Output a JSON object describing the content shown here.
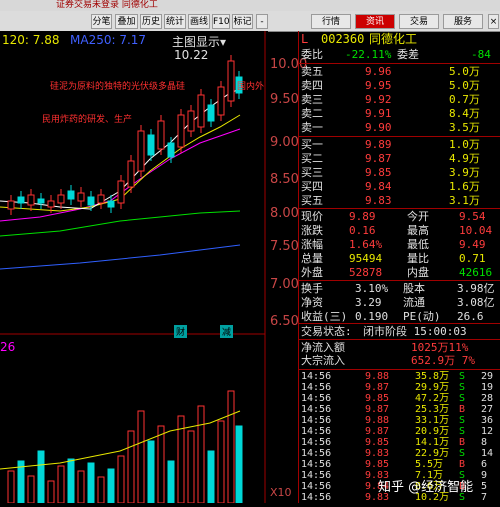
{
  "window_title": "证券交易未登录  同德化工",
  "toolbar": [
    "分笔",
    "叠加",
    "历史",
    "统计",
    "画线",
    "F10",
    "标记",
    "-"
  ],
  "toolbar_right": [
    "行情",
    "资讯",
    "交易",
    "服务"
  ],
  "ma": {
    "ma120": "120: 7.88",
    "ma250": "MA250: 7.17",
    "mode": "主图显示"
  },
  "price_axis": [
    "10.00",
    "9.50",
    "9.00",
    "8.50",
    "8.00",
    "7.50",
    "7.00",
    "6.50"
  ],
  "high_label": "10.22",
  "annotations": [
    "硅泥为原料的独特的光伏级多晶硅",
    "国内外",
    "民用炸药的研发、生产"
  ],
  "vol_scale": "26",
  "vol_axis": "X10",
  "bottom_marks": [
    "财",
    "减"
  ],
  "chart_colors": {
    "up": "#ff3232",
    "down": "#00d8d8",
    "ma5": "#ffffff",
    "ma10": "#e8e800",
    "ma20": "#ff00ff",
    "ma60": "#00e000",
    "ma120": "#3060ff"
  },
  "stock": {
    "code": "002360",
    "name": "同德化工",
    "weibi_label": "委比",
    "weibi": "-22.11%",
    "weicha_label": "委差",
    "weicha": "-84"
  },
  "asks": [
    {
      "label": "卖五",
      "price": "9.96",
      "vol": "5.0万"
    },
    {
      "label": "卖四",
      "price": "9.95",
      "vol": "5.0万"
    },
    {
      "label": "卖三",
      "price": "9.92",
      "vol": "0.7万"
    },
    {
      "label": "卖二",
      "price": "9.91",
      "vol": "8.4万"
    },
    {
      "label": "卖一",
      "price": "9.90",
      "vol": "3.5万"
    }
  ],
  "bids": [
    {
      "label": "买一",
      "price": "9.89",
      "vol": "1.0万"
    },
    {
      "label": "买二",
      "price": "9.87",
      "vol": "4.9万"
    },
    {
      "label": "买三",
      "price": "9.85",
      "vol": "3.9万"
    },
    {
      "label": "买四",
      "price": "9.84",
      "vol": "1.6万"
    },
    {
      "label": "买五",
      "price": "9.83",
      "vol": "3.1万"
    }
  ],
  "stats": [
    {
      "l1": "现价",
      "v1": "9.89",
      "l2": "今开",
      "v2": "9.54",
      "c1": "red",
      "c2": "red"
    },
    {
      "l1": "涨跌",
      "v1": "0.16",
      "l2": "最高",
      "v2": "10.04",
      "c1": "red",
      "c2": "red"
    },
    {
      "l1": "涨幅",
      "v1": "1.64%",
      "l2": "最低",
      "v2": "9.49",
      "c1": "red",
      "c2": "red"
    },
    {
      "l1": "总量",
      "v1": "95494",
      "l2": "量比",
      "v2": "0.71",
      "c1": "yel",
      "c2": "yel"
    },
    {
      "l1": "外盘",
      "v1": "52878",
      "l2": "内盘",
      "v2": "42616",
      "c1": "red",
      "c2": "grn"
    }
  ],
  "stats2": [
    {
      "l1": "换手",
      "v1": "3.10%",
      "l2": "股本",
      "v2": "3.98亿"
    },
    {
      "l1": "净资",
      "v1": "3.29",
      "l2": "流通",
      "v2": "3.08亿"
    },
    {
      "l1": "收益(三)",
      "v1": "0.190",
      "l2": "PE(动)",
      "v2": "26.6"
    }
  ],
  "trade_status": {
    "label": "交易状态:",
    "value": "闭市阶段 15:00:03"
  },
  "netflow": [
    {
      "label": "净流入额",
      "value": "1025万11%"
    },
    {
      "label": "大宗流入",
      "value": "652.9万 7%"
    }
  ],
  "ticks": [
    {
      "t": "14:56",
      "p": "9.88",
      "v": "35.8万",
      "d": "S",
      "n": "29"
    },
    {
      "t": "14:56",
      "p": "9.87",
      "v": "29.9万",
      "d": "S",
      "n": "19"
    },
    {
      "t": "14:56",
      "p": "9.85",
      "v": "47.2万",
      "d": "S",
      "n": "28"
    },
    {
      "t": "14:56",
      "p": "9.87",
      "v": "25.3万",
      "d": "B",
      "n": "27"
    },
    {
      "t": "14:56",
      "p": "9.88",
      "v": "33.1万",
      "d": "S",
      "n": "36"
    },
    {
      "t": "14:56",
      "p": "9.87",
      "v": "20.9万",
      "d": "S",
      "n": "12"
    },
    {
      "t": "14:56",
      "p": "9.85",
      "v": "14.1万",
      "d": "B",
      "n": "8"
    },
    {
      "t": "14:56",
      "p": "9.83",
      "v": "22.9万",
      "d": "S",
      "n": "14"
    },
    {
      "t": "14:56",
      "p": "9.85",
      "v": "5.5万",
      "d": "B",
      "n": "6"
    },
    {
      "t": "14:56",
      "p": "9.83",
      "v": "7.1万",
      "d": "S",
      "n": "9"
    },
    {
      "t": "14:56",
      "p": "9.84",
      "v": "8.6万",
      "d": "B",
      "n": "5"
    },
    {
      "t": "14:56",
      "p": "9.83",
      "v": "10.2万",
      "d": "S",
      "n": "7"
    }
  ],
  "watermark": "知乎 @经济智能"
}
